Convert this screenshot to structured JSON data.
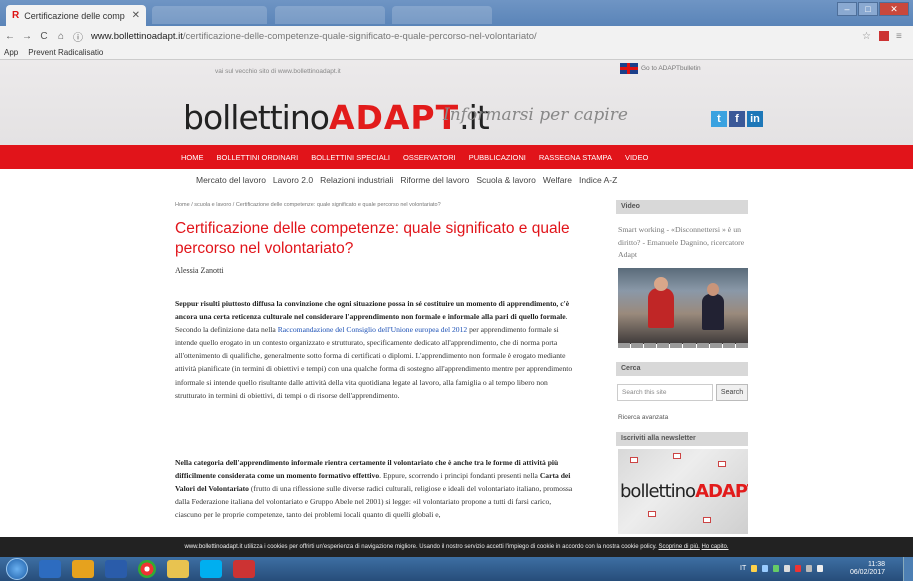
{
  "browser": {
    "tab_title": "Certificazione delle comp",
    "tab_favicon": "R",
    "url_host": "www.bollettinoadapt.it",
    "url_path": "/certificazione-delle-competenze-quale-significato-e-quale-percorso-nel-volontariato/",
    "bookmarks": [
      "App",
      "Prevent Radicalisatio"
    ]
  },
  "header": {
    "old_site": "vai sul vecchio sito di www.bollettinoadapt.it",
    "go_adapt": "Go to ADAPTbulletin",
    "logo_main": "bollettino",
    "logo_red": "ADAPT",
    "logo_tld": ".it",
    "tagline": "Informarsi per capire",
    "social": [
      "twitter-icon",
      "facebook-icon",
      "linkedin-icon"
    ]
  },
  "nav": {
    "main": [
      "HOME",
      "BOLLETTINI ORDINARI",
      "BOLLETTINI SPECIALI",
      "OSSERVATORI",
      "PUBBLICAZIONI",
      "RASSEGNA STAMPA",
      "VIDEO"
    ],
    "sub": [
      "Mercato del lavoro",
      "Lavoro 2.0",
      "Relazioni industriali",
      "Riforme del lavoro",
      "Scuola & lavoro",
      "Welfare",
      "Indice A-Z"
    ]
  },
  "article": {
    "breadcrumb": "Home / scuola e lavoro / Certificazione delle competenze: quale significato e quale percorso nel volontariato?",
    "title": "Certificazione delle competenze: quale significato e quale percorso nel volontariato?",
    "author": "Alessia Zanotti",
    "p1_bold": "Seppur risulti piuttosto diffusa la convinzione che ogni situazione possa in sé costituire un momento di apprendimento, c'è ancora una certa reticenza culturale nel considerare l'apprendimento non formale e informale alla pari di quello formale",
    "p1_a": ". Secondo la definizione data nella ",
    "p1_link": "Raccomandazione del Consiglio dell'Unione europea del 2012",
    "p1_b": " per apprendimento formale si intende quello erogato in un contesto organizzato e strutturato, specificamente dedicato all'apprendimento, che di norma porta all'ottenimento di qualifiche, generalmente sotto forma di certificati o diplomi. L'apprendimento non formale è erogato mediante attività pianificate (in termini di obiettivi e tempi) con una qualche forma di sostegno all'apprendimento mentre per apprendimento informale si intende quello risultante dalle attività della vita quotidiana legate al lavoro, alla famiglia o al tempo libero non strutturato in termini di obiettivi, di tempi o di risorse dell'apprendimento.",
    "p2_bold": "Nella categoria dell'apprendimento informale rientra certamente il volontariato che è anche tra le forme di attività più difficilmente considerata come un momento formativo effettivo",
    "p2_a": ". Eppure, scorrendo i principi fondanti presenti nella ",
    "p2_bold2": "Carta dei Valori del Volontariato",
    "p2_b": " (frutto di una riflessione sulle diverse radici culturali, religiose e ideali del volontariato italiano, promossa dalla Federazione italiana del volontariato e Gruppo Abele nel 2001) si legge: «il volontariato propone a tutti di farsi carico, ciascuno per le proprie competenze, tanto dei problemi locali quanto di quelli globali e,"
  },
  "sidebar": {
    "video_head": "Video",
    "video_title": "Smart working - «Disconnettersi » è un diritto? - Emanuele Dagnino, ricercatore Adapt",
    "cerca_head": "Cerca",
    "search_placeholder": "Search this site",
    "search_button": "Search",
    "advanced": "Ricerca avanzata",
    "newsletter_head": "Iscriviti alla newsletter",
    "news_logo_main": "bollettino",
    "news_logo_red": "ADAPT"
  },
  "cookie": {
    "text": "www.bollettinoadapt.it utilizza i cookies per offrirti un'esperienza di navigazione migliore. Usando il nostro servizio accetti l'impiego di cookie in accordo con la nostra cookie policy.",
    "more": "Scoprine di più.",
    "ok": "Ho capito."
  },
  "taskbar": {
    "time": "11:38",
    "date": "06/02/2017",
    "lang": "IT"
  }
}
